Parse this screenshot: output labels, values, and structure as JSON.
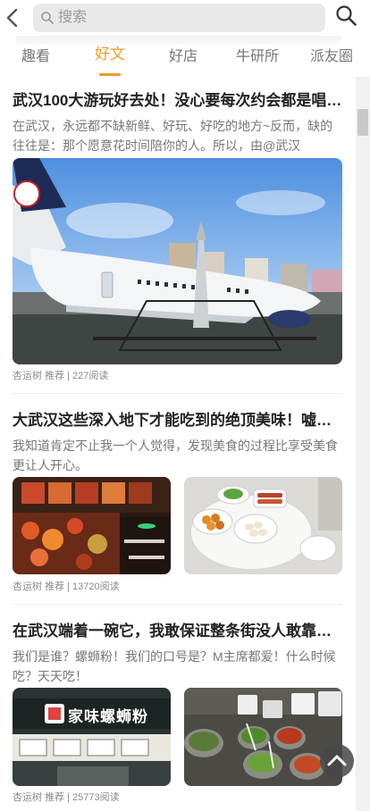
{
  "search": {
    "placeholder": "搜索"
  },
  "tabs": [
    {
      "label": "趣看"
    },
    {
      "label": "好文"
    },
    {
      "label": "好店"
    },
    {
      "label": "牛研所"
    },
    {
      "label": "派友圈"
    }
  ],
  "articles": [
    {
      "title": "武汉100大游玩好去处！没心要每次约会都是唱…",
      "desc": "在武汉，永远都不缺新鲜、好玩、好吃的地方~反而，缺的往往是：那个愿意花时间陪你的人。所以，由@武汉",
      "meta": "杏运树 推荐 | 227阅读"
    },
    {
      "title": "大武汉这些深入地下才能吃到的绝顶美味！嘘…",
      "desc": "我知道肯定不止我一个人觉得，发现美食的过程比享受美食更让人开心。",
      "meta": "杏运树 推荐 | 13720阅读"
    },
    {
      "title": "在武汉端着一碗它，我敢保证整条街没人敢靠…",
      "desc": "我们是谁？螺蛳粉！我们的口号是？M主席都爱！什么时候吃？天天吃！",
      "meta": "杏运树 推荐 | 25773阅读",
      "shop_sign": "家味螺蛳粉"
    }
  ],
  "colors": {
    "accent": "#f29a1f"
  }
}
